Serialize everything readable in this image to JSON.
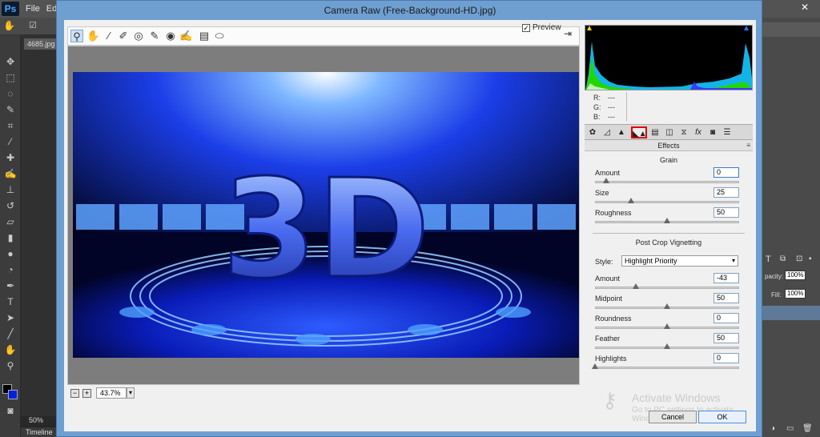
{
  "photoshop": {
    "logo": "Ps",
    "menus": [
      "File",
      "Ed"
    ],
    "doc_tab": "4685.jpg",
    "zoom": "50%",
    "timeline_label": "Timeline",
    "opacity_label": "pacity:",
    "opacity_value": "100%",
    "fill_label": "Fill:",
    "fill_value": "100%"
  },
  "dialog": {
    "title": "Camera Raw (Free-Background-HD.jpg)",
    "preview_label": "Preview",
    "preview_checked": true,
    "zoom_value": "43.7%",
    "image_text": "3D"
  },
  "readout": {
    "r_label": "R:",
    "r_value": "---",
    "g_label": "G:",
    "g_value": "---",
    "b_label": "B:",
    "b_value": "---"
  },
  "panel": {
    "title": "Effects",
    "grain": {
      "title": "Grain",
      "sliders": [
        {
          "label": "Amount",
          "value": "0",
          "level": 0.08
        },
        {
          "label": "Size",
          "value": "25",
          "level": 0.25
        },
        {
          "label": "Roughness",
          "value": "50",
          "level": 0.5
        }
      ]
    },
    "vignette": {
      "title": "Post Crop Vignetting",
      "style_label": "Style:",
      "style_value": "Highlight Priority",
      "sliders": [
        {
          "label": "Amount",
          "value": "-43",
          "level": 0.285
        },
        {
          "label": "Midpoint",
          "value": "50",
          "level": 0.5
        },
        {
          "label": "Roundness",
          "value": "0",
          "level": 0.5
        },
        {
          "label": "Feather",
          "value": "50",
          "level": 0.5
        },
        {
          "label": "Highlights",
          "value": "0",
          "level": 0.0
        }
      ]
    }
  },
  "buttons": {
    "cancel": "Cancel",
    "ok": "OK"
  },
  "watermark": {
    "title": "Activate Windows",
    "subtitle": "Go to PC settings to activate Windows."
  },
  "colors": {
    "dialog_frame": "#6f9fd1",
    "active_tab_highlight": "#e00000",
    "accent": "#3a7ad0"
  }
}
